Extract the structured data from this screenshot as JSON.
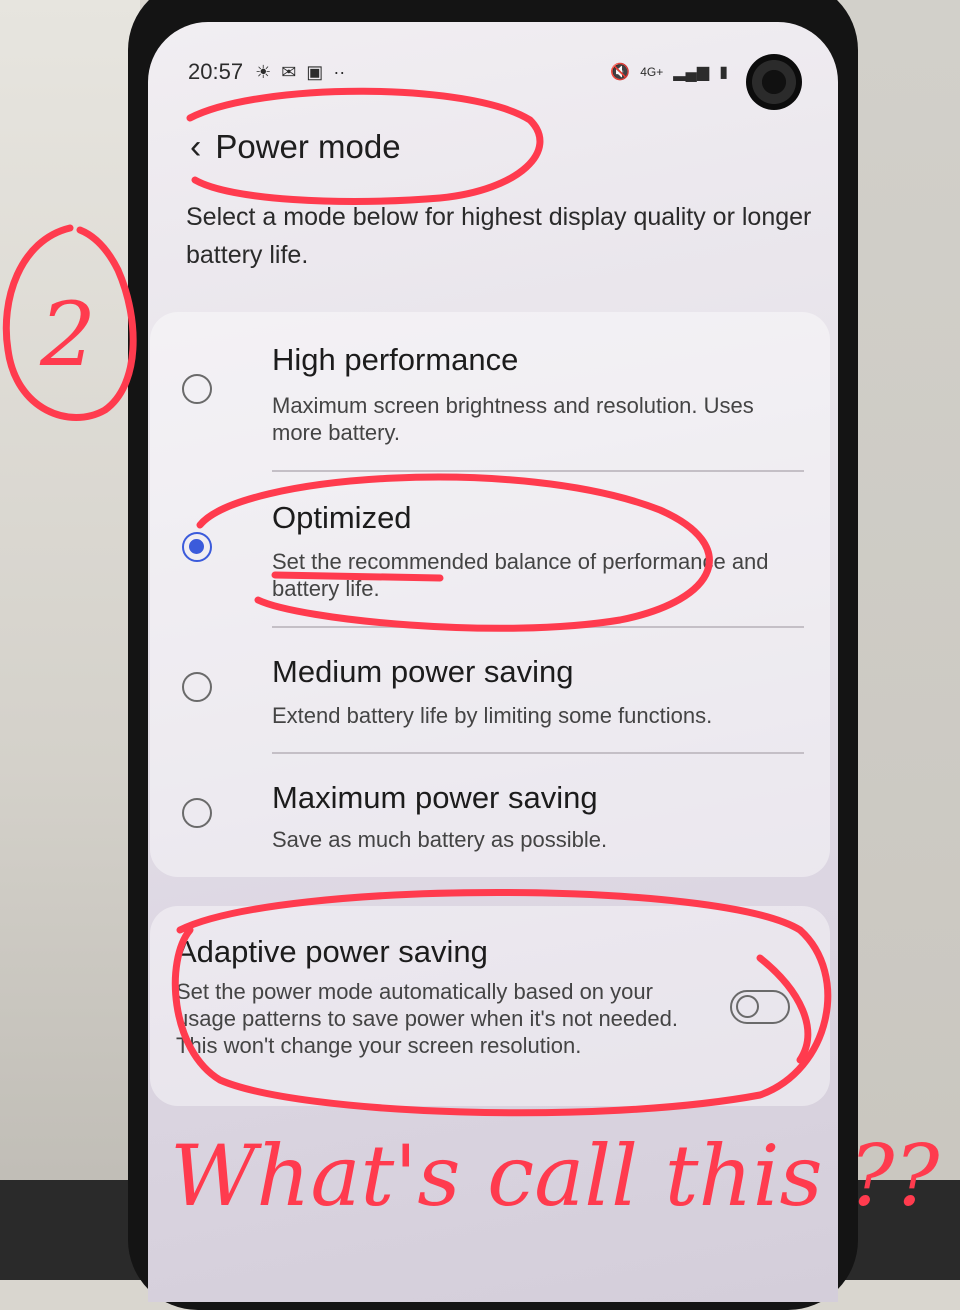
{
  "status_bar": {
    "time": "20:57",
    "network": "4G+",
    "icons": [
      "weather-icon",
      "mail-icon",
      "calendar-icon",
      "more-notifications-icon",
      "mute-icon",
      "signal-icon",
      "battery-icon"
    ]
  },
  "header": {
    "title": "Power mode",
    "back_icon": "back-arrow-icon"
  },
  "description": "Select a mode below for highest display quality or longer battery life.",
  "options": [
    {
      "title": "High performance",
      "desc": "Maximum screen brightness and resolution. Uses more battery.",
      "selected": false
    },
    {
      "title": "Optimized",
      "desc": "Set the recommended balance of performance and battery life.",
      "selected": true
    },
    {
      "title": "Medium power saving",
      "desc": "Extend battery life by limiting some functions.",
      "selected": false
    },
    {
      "title": "Maximum power saving",
      "desc": "Save as much battery as possible.",
      "selected": false
    }
  ],
  "adaptive": {
    "title": "Adaptive power saving",
    "desc": "Set the power mode automatically based on your usage patterns to save power when it's not needed. This won't change your screen resolution.",
    "enabled": false
  },
  "annotations": {
    "number": "2",
    "question": "What's call this ??"
  },
  "colors": {
    "accent": "#3b5bdb",
    "ink": "#ff3b4e"
  }
}
